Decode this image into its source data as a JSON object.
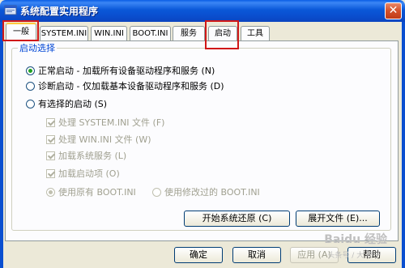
{
  "window": {
    "title": "系统配置实用程序",
    "close_label": "✕"
  },
  "tabs": [
    {
      "label": "一般"
    },
    {
      "label": "SYSTEM.INI"
    },
    {
      "label": "WIN.INI"
    },
    {
      "label": "BOOT.INI"
    },
    {
      "label": "服务"
    },
    {
      "label": "启动"
    },
    {
      "label": "工具"
    }
  ],
  "group": {
    "title": "启动选择",
    "options": [
      {
        "label": "正常启动 - 加载所有设备驱动程序和服务 (N)",
        "selected": true
      },
      {
        "label": "诊断启动 - 仅加载基本设备驱动程序和服务 (D)",
        "selected": false
      },
      {
        "label": "有选择的启动 (S)",
        "selected": false
      }
    ],
    "checks": [
      {
        "label": "处理 SYSTEM.INI 文件 (F)",
        "checked": true
      },
      {
        "label": "处理 WIN.INI 文件 (W)",
        "checked": true
      },
      {
        "label": "加载系统服务 (L)",
        "checked": true
      },
      {
        "label": "加载启动项 (O)",
        "checked": true
      }
    ],
    "boot_ini": [
      {
        "label": "使用原有 BOOT.INI",
        "selected": true
      },
      {
        "label": "使用修改过的 BOOT.INI",
        "selected": false
      }
    ],
    "restore_button": "开始系统还原 (C)",
    "expand_button": "展开文件 (E)..."
  },
  "footer": {
    "ok": "确定",
    "cancel": "取消",
    "apply": "应用 (A)",
    "help": "帮助"
  },
  "watermark": {
    "brand": "Baidu 经验",
    "caption": "头条号 / 大 脐子"
  }
}
